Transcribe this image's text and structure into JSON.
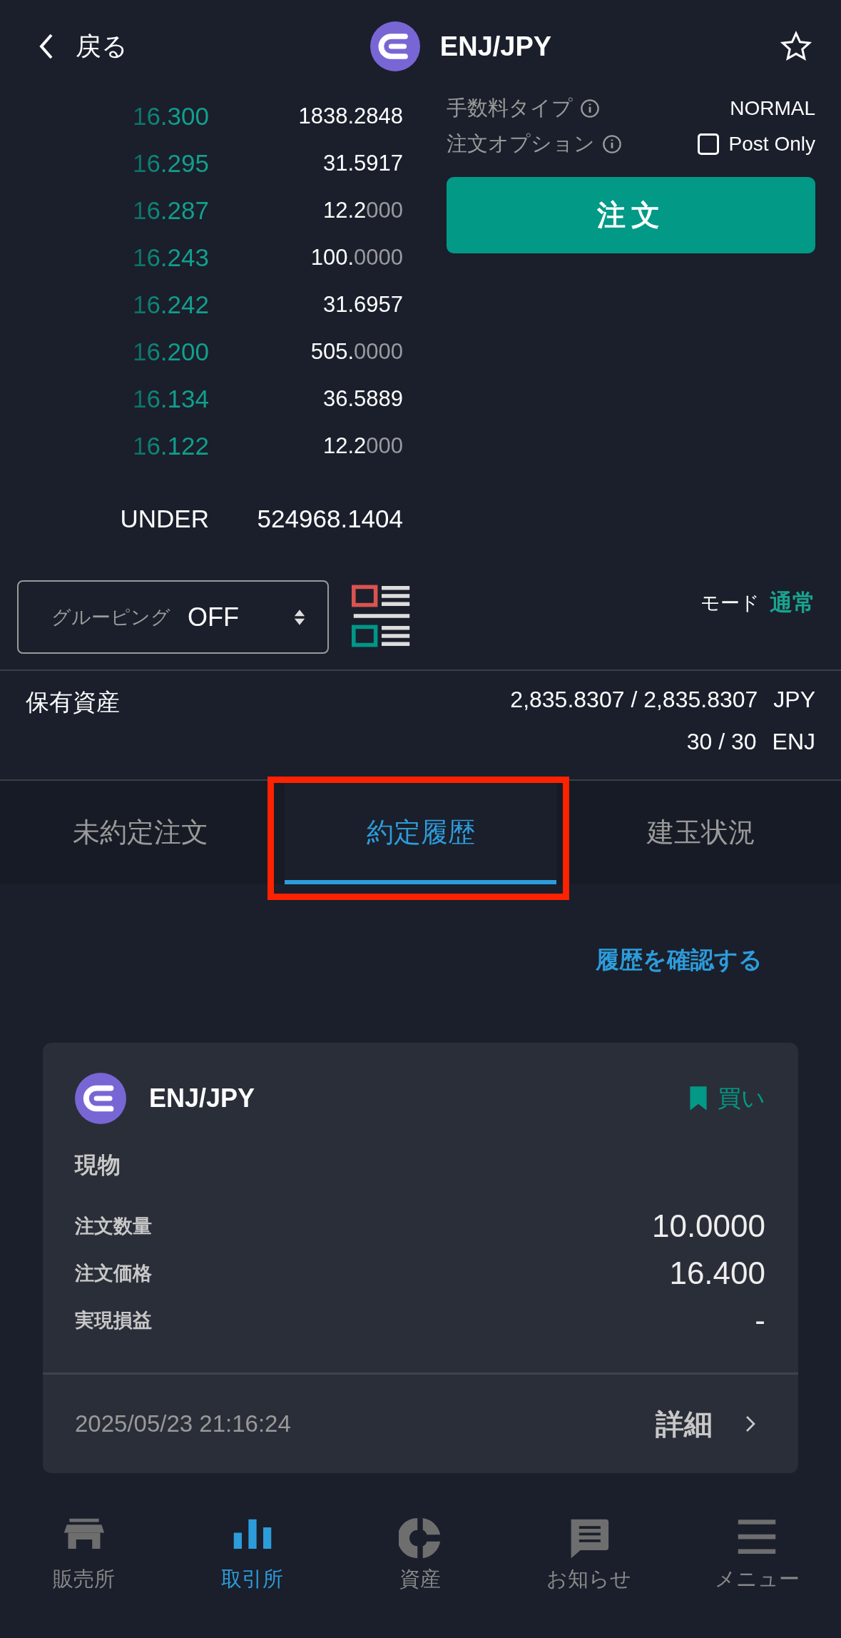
{
  "header": {
    "back_label": "戻る",
    "pair": "ENJ/JPY",
    "favorite": false
  },
  "order_book": {
    "asks": [
      {
        "price": "16.300",
        "amount": "1838.2848"
      },
      {
        "price": "16.295",
        "amount": "31.5917"
      },
      {
        "price": "16.287",
        "amount": "12.2",
        "amount_trail": "000"
      },
      {
        "price": "16.243",
        "amount": "100.",
        "amount_trail": "0000"
      },
      {
        "price": "16.242",
        "amount": "31.6957"
      },
      {
        "price": "16.200",
        "amount": "505.",
        "amount_trail": "0000"
      },
      {
        "price": "16.134",
        "amount": "36.5889"
      },
      {
        "price": "16.122",
        "amount": "12.2",
        "amount_trail": "000"
      }
    ],
    "under_label": "UNDER",
    "under_value": "524968.1404"
  },
  "order_panel": {
    "fee_label": "手数料タイプ",
    "fee_value": "NORMAL",
    "option_label": "注文オプション",
    "post_only": {
      "label": "Post Only",
      "checked": false
    },
    "order_button": "注文"
  },
  "grouping": {
    "label": "グルーピング",
    "value": "OFF"
  },
  "mode": {
    "label": "モード",
    "value": "通常"
  },
  "holdings": {
    "label": "保有資産",
    "rows": [
      {
        "value": "2,835.8307 / 2,835.8307",
        "unit": "JPY"
      },
      {
        "value": "30 / 30",
        "unit": "ENJ"
      }
    ]
  },
  "tabs": [
    {
      "label": "未約定注文",
      "selected": false,
      "highlighted": false
    },
    {
      "label": "約定履歴",
      "selected": true,
      "highlighted": true
    },
    {
      "label": "建玉状況",
      "selected": false,
      "highlighted": false
    }
  ],
  "history_link": "履歴を確認する",
  "trade_card": {
    "pair": "ENJ/JPY",
    "side": "買い",
    "category": "現物",
    "fields": [
      {
        "label": "注文数量",
        "value": "10.0000"
      },
      {
        "label": "注文価格",
        "value": "16.400"
      },
      {
        "label": "実現損益",
        "value": "-"
      }
    ],
    "datetime": "2025/05/23 21:16:24",
    "detail_label": "詳細"
  },
  "bottom_nav": [
    {
      "kind": "store",
      "label": "販売所",
      "selected": false
    },
    {
      "kind": "chart",
      "label": "取引所",
      "selected": true
    },
    {
      "kind": "assets",
      "label": "資産",
      "selected": false
    },
    {
      "kind": "news",
      "label": "お知らせ",
      "selected": false
    },
    {
      "kind": "menu",
      "label": "メニュー",
      "selected": false
    }
  ]
}
